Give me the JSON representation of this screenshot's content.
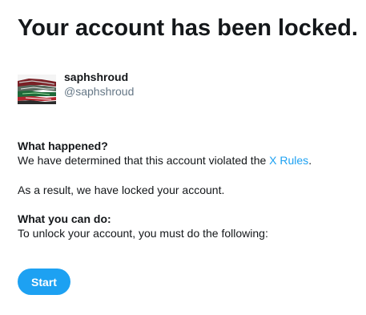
{
  "title": "Your account has been locked.",
  "profile": {
    "display_name": "saphshroud",
    "handle": "@saphshroud",
    "avatar_icon": "profile-avatar-image"
  },
  "what_happened": {
    "heading": "What happened?",
    "text_before_link": "We have determined that this account violated the ",
    "link_text": "X Rules",
    "text_after_link": "."
  },
  "result_text": "As a result, we have locked your account.",
  "what_you_can_do": {
    "heading": "What you can do:",
    "text": "To unlock your account, you must do the following:"
  },
  "start_button": {
    "label": "Start"
  },
  "colors": {
    "accent": "#1da1f2",
    "text": "#14171a",
    "muted": "#657786"
  }
}
